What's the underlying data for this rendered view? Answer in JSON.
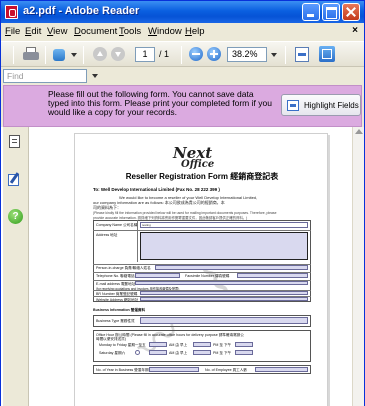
{
  "window": {
    "title": "a2.pdf - Adobe Reader"
  },
  "menu": {
    "items": [
      {
        "label": "File",
        "underline": "F",
        "rest": "ile"
      },
      {
        "label": "Edit",
        "underline": "E",
        "rest": "dit"
      },
      {
        "label": "View",
        "underline": "V",
        "rest": "iew"
      },
      {
        "label": "Document",
        "underline": "D",
        "rest": "ocument"
      },
      {
        "label": "Tools",
        "underline": "T",
        "rest": "ools"
      },
      {
        "label": "Window",
        "underline": "W",
        "rest": "indow"
      },
      {
        "label": "Help",
        "underline": "H",
        "rest": "elp"
      }
    ],
    "close_glyph": "×"
  },
  "toolbar": {
    "current_page": "1",
    "page_total": "/ 1",
    "zoom": "38.2%"
  },
  "find": {
    "placeholder": "Find"
  },
  "form_bar": {
    "message": "Please fill out the following form. You cannot save data typed into this form. Please print your completed form if you would like a copy for your records.",
    "highlight_button": "Highlight Fields"
  },
  "navpane": {
    "help_glyph": "?"
  },
  "document": {
    "logo_next": "Next",
    "logo_office": "Office",
    "title": "Reseller Registration Form 經銷商登記表",
    "to_line": "To: Well Develop International Limited (Fax No. 28 222 399 )",
    "intro_1": "We would like to become a reseller of your Well Develop International Limited,",
    "intro_2": "our company information are as follows: 本公司欲成為貴公司的經銷商，本",
    "intro_3": "司的資料為下：",
    "note_1": "(Please kindly fill the information provided below will be used for mailing important documents purposes. Therefore, please",
    "note_2": "provide accurate information. 請詳細下列資料將會用作郵寄重要文件，因此敬請客戶提供正確的資料。)",
    "company_name_label": "Company Name 公司名稱",
    "company_name_value": "testing",
    "address_label": "Address 地址",
    "person_label": "Person-in-charge 負責/聯絡人姓名",
    "telephone_label": "Telephone No. 聯絡電話",
    "fax_label": "Facsimile Number 傳真號碼",
    "email_label": "E-mail address 電郵地址",
    "email_note": "(for receiving quotations and invoices 用作接收報價及發票)",
    "br_label": "BR Number 商業登記號碼",
    "website_label": "Website Address 網站地址",
    "business_info_label": "Business Information 營運資料",
    "business_type_label": "Business Type 業務性質",
    "office_hours_label": "Office Hour 辦公時間 (Please fill in accurate office hours for delivery purpose 請準確填寫辦公",
    "office_hours_sub": "時間以便安排送貨)",
    "mon_fri_label": "Monday to Friday 星期一至五",
    "sat_label": "Saturday 星期六",
    "am_from": "AM 由 早上",
    "pm_to": "PM 至 下午",
    "years_label": "No. of Year in Business 營運年期",
    "employees_label": "No. of Employee 員工人數"
  }
}
